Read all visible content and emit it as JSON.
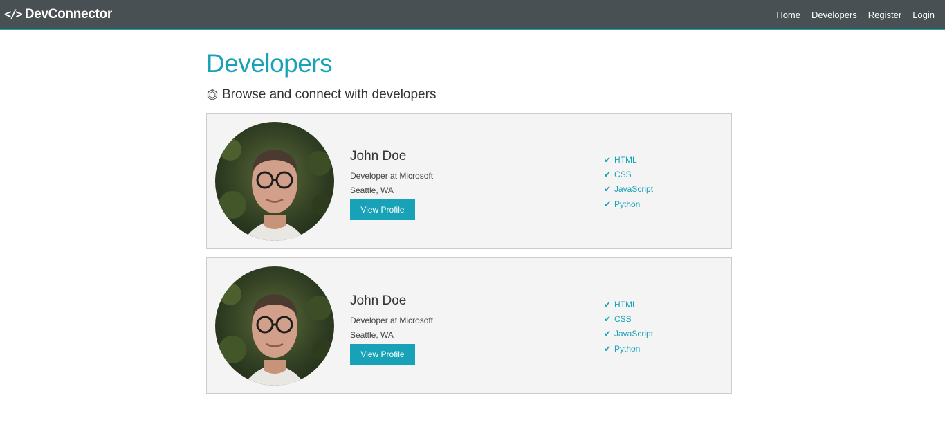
{
  "navbar": {
    "brand_icon": "</>",
    "brand": "DevConnector",
    "links": [
      "Home",
      "Developers",
      "Register",
      "Login"
    ]
  },
  "page": {
    "title": "Developers",
    "lead_icon": "hexagon-icon",
    "lead": "Browse and connect with developers"
  },
  "profiles": [
    {
      "name": "John Doe",
      "job": "Developer at Microsoft",
      "location": "Seattle, WA",
      "button": "View Profile",
      "skills": [
        "HTML",
        "CSS",
        "JavaScript",
        "Python"
      ]
    },
    {
      "name": "John Doe",
      "job": "Developer at Microsoft",
      "location": "Seattle, WA",
      "button": "View Profile",
      "skills": [
        "HTML",
        "CSS",
        "JavaScript",
        "Python"
      ]
    }
  ],
  "colors": {
    "accent": "#17a2b8",
    "navbar": "#495053",
    "card": "#f4f4f4"
  }
}
